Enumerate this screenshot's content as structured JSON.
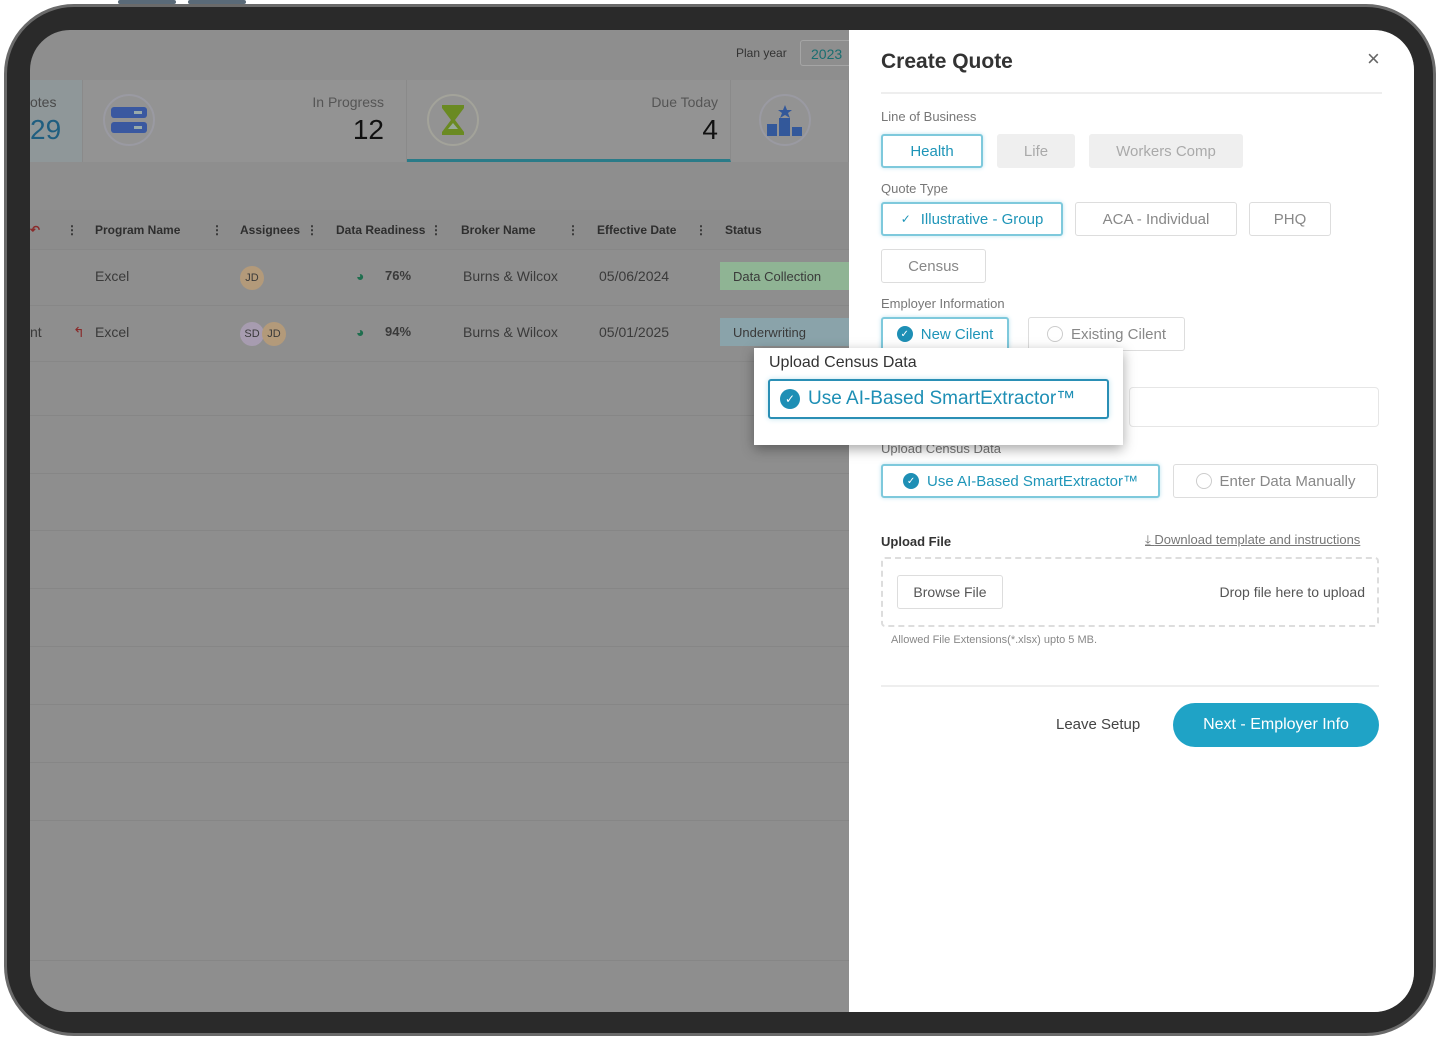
{
  "topbar": {
    "plan_year_label": "Plan year",
    "plan_year_value": "2023"
  },
  "stats": [
    {
      "label": "otes",
      "value": "29",
      "icon": "server-icon"
    },
    {
      "label": "In Progress",
      "value": "12",
      "icon": "hourglass-icon"
    },
    {
      "label": "Due Today",
      "value": "4",
      "icon": "podium-icon"
    }
  ],
  "table": {
    "columns": [
      "Program Name",
      "Assignees",
      "Data Readiness",
      "Broker Name",
      "Effective Date",
      "Status"
    ],
    "rows": [
      {
        "prefix": "",
        "program": "Excel",
        "assignees": [
          "JD"
        ],
        "readiness": "76%",
        "broker": "Burns & Wilcox",
        "date": "05/06/2024",
        "status": "Data Collection"
      },
      {
        "prefix": "nt",
        "program": "Excel",
        "assignees": [
          "SD",
          "JD"
        ],
        "readiness": "94%",
        "broker": "Burns & Wilcox",
        "date": "05/01/2025",
        "status": "Underwriting"
      }
    ]
  },
  "modal": {
    "title": "Create Quote",
    "line_of_business": {
      "label": "Line of Business",
      "options": [
        "Health",
        "Life",
        "Workers Comp"
      ],
      "selected": "Health"
    },
    "quote_type": {
      "label": "Quote Type",
      "options": [
        "Illustrative - Group",
        "ACA - Individual",
        "PHQ",
        "Census"
      ],
      "selected": "Illustrative - Group"
    },
    "employer": {
      "label": "Employer Information",
      "options": [
        "New Cilent",
        "Existing Cilent"
      ],
      "selected": "New Cilent"
    },
    "census": {
      "label": "Upload Census Data",
      "options": [
        "Use AI-Based SmartExtractor™",
        "Enter Data Manually"
      ],
      "selected": "Use AI-Based SmartExtractor™"
    },
    "upload": {
      "label": "Upload File",
      "download_link": "Download template and instructions",
      "browse": "Browse File",
      "drop": "Drop file here to upload",
      "hint": "Allowed File Extensions(*.xlsx) upto 5 MB."
    },
    "leave": "Leave Setup",
    "next": "Next - Employer Info"
  },
  "popout": {
    "label": "Upload Census Data",
    "option": "Use AI-Based SmartExtractor™"
  },
  "colors": {
    "accent": "#1e9bbd",
    "next_button": "#1fa3c6",
    "status_green": "#8fb494",
    "status_blue": "#8aa3aa"
  }
}
